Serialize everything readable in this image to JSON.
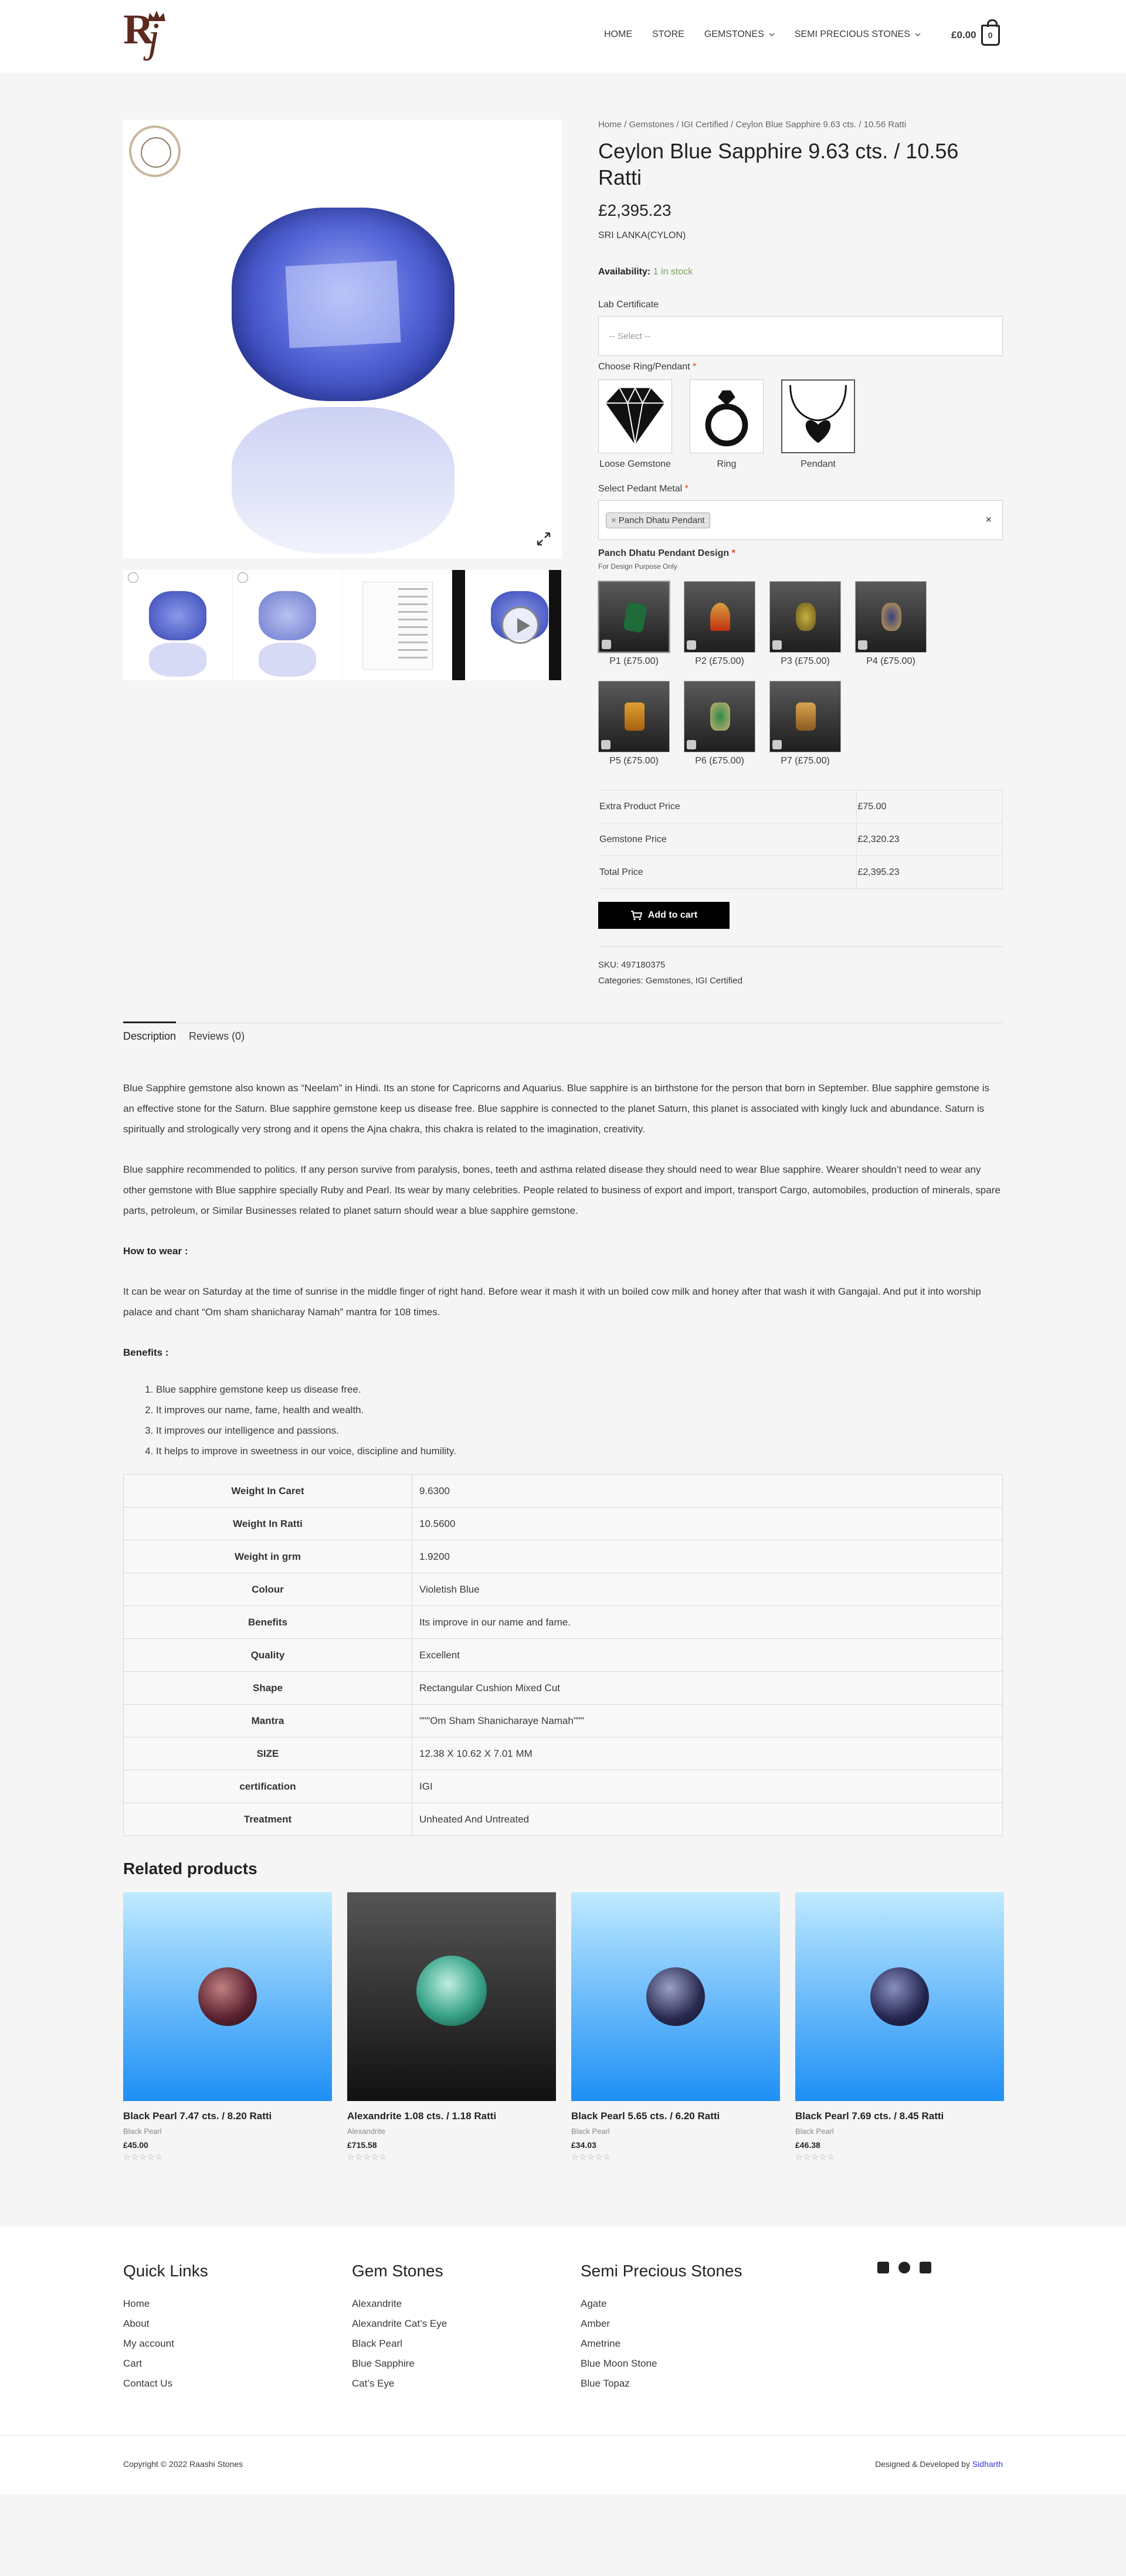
{
  "header": {
    "logo_text": "Rj",
    "nav": [
      "HOME",
      "STORE",
      "GEMSTONES",
      "SEMI PRECIOUS STONES"
    ],
    "cart_total": "£0.00",
    "cart_count": "0"
  },
  "product": {
    "breadcrumb": "Home / Gemstones / IGI Certified / Ceylon Blue Sapphire 9.63 cts. / 10.56 Ratti",
    "title": "Ceylon Blue Sapphire 9.63 cts. / 10.56 Ratti",
    "price": "£2,395.23",
    "origin": "SRI LANKA(CYLON)",
    "availability_label": "Availability:",
    "availability_value": "1 in stock",
    "lab_certificate_label": "Lab Certificate",
    "lab_certificate_placeholder": "-- Select --",
    "choose_label": "Choose Ring/Pendant",
    "choices": [
      "Loose Gemstone",
      "Ring",
      "Pendant"
    ],
    "metal_label": "Select Pedant Metal",
    "metal_selected": "Panch Dhatu Pendant",
    "design_label": "Panch Dhatu Pendant Design",
    "design_sub": "For Design Purpose Only",
    "designs": [
      "P1 (£75.00)",
      "P2 (£75.00)",
      "P3 (£75.00)",
      "P4 (£75.00)",
      "P5 (£75.00)",
      "P6 (£75.00)",
      "P7 (£75.00)"
    ],
    "price_rows": [
      {
        "label": "Extra Product Price",
        "value": "£75.00"
      },
      {
        "label": "Gemstone Price",
        "value": "£2,320.23"
      },
      {
        "label": "Total Price",
        "value": "£2,395.23"
      }
    ],
    "add_to_cart": "Add to cart",
    "sku": "SKU: 497180375",
    "categories_label": "Categories:",
    "categories": "Gemstones, IGI Certified"
  },
  "tabs": [
    "Description",
    "Reviews (0)"
  ],
  "description": {
    "p1": "Blue Sapphire gemstone also known as “Neelam” in Hindi. Its an stone for Capricorns and Aquarius. Blue sapphire is an birthstone for the person that born in September. Blue sapphire gemstone is an effective stone for the Saturn. Blue sapphire gemstone keep us disease free. Blue sapphire is connected to the planet Saturn, this planet is associated with kingly luck and abundance. Saturn is spiritually and strologically very strong and it opens the Ajna chakra, this chakra is related to the imagination, creativity.",
    "p2": "Blue sapphire recommended to politics. If any person survive from paralysis, bones, teeth and asthma related disease they should need to wear Blue sapphire. Wearer shouldn’t need to wear any other gemstone with Blue sapphire specially Ruby and Pearl. Its wear by many celebrities. People related to business of export and import, transport Cargo, automobiles, production of minerals, spare parts, petroleum, or Similar Businesses related to planet saturn should wear a blue sapphire gemstone.",
    "how_heading": "How to wear :",
    "how_text": "It can be wear on Saturday at the time of sunrise in the middle finger of right hand. Before wear it mash it with un boiled cow milk and honey after that wash it with Gangajal. And put it into worship palace and chant “Om sham shanicharay Namah” mantra for 108 times.",
    "benefits_heading": "Benefits :",
    "benefits": [
      "Blue sapphire gemstone keep us disease free.",
      "It improves our name, fame, health and wealth.",
      "It improves our intelligence and passions.",
      "It helps to improve in sweetness in our voice, discipline and humility."
    ]
  },
  "specs": [
    {
      "k": "Weight In Caret",
      "v": "9.6300"
    },
    {
      "k": "Weight In Ratti",
      "v": "10.5600"
    },
    {
      "k": "Weight in grm",
      "v": "1.9200"
    },
    {
      "k": "Colour",
      "v": "Violetish Blue"
    },
    {
      "k": "Benefits",
      "v": "Its improve in our name and fame."
    },
    {
      "k": "Quality",
      "v": "Excellent"
    },
    {
      "k": "Shape",
      "v": "Rectangular Cushion Mixed Cut"
    },
    {
      "k": "Mantra",
      "v": "\"\"\"Om Sham Shanicharaye Namah\"\"\""
    },
    {
      "k": "SIZE",
      "v": "12.38 X 10.62 X 7.01 MM"
    },
    {
      "k": "certification",
      "v": "IGI"
    },
    {
      "k": "Treatment",
      "v": "Unheated And Untreated"
    }
  ],
  "related": {
    "title": "Related products",
    "items": [
      {
        "name": "Black Pearl 7.47 cts. / 8.20 Ratti",
        "category": "Black Pearl",
        "price": "£45.00",
        "stars": "☆☆☆☆☆"
      },
      {
        "name": "Alexandrite 1.08 cts. / 1.18 Ratti",
        "category": "Alexandrite",
        "price": "£715.58",
        "stars": "☆☆☆☆☆"
      },
      {
        "name": "Black Pearl 5.65 cts. / 6.20 Ratti",
        "category": "Black Pearl",
        "price": "£34.03",
        "stars": "☆☆☆☆☆"
      },
      {
        "name": "Black Pearl 7.69 cts. / 8.45 Ratti",
        "category": "Black Pearl",
        "price": "£46.38",
        "stars": "☆☆☆☆☆"
      }
    ]
  },
  "footer": {
    "quick_links_title": "Quick Links",
    "quick_links": [
      "Home",
      "About",
      "My account",
      "Cart",
      "Contact Us"
    ],
    "gem_title": "Gem Stones",
    "gem_links": [
      "Alexandrite",
      "Alexandrite Cat’s Eye",
      "Black Pearl",
      "Blue Sapphire",
      "Cat’s Eye"
    ],
    "semi_title": "Semi Precious Stones",
    "semi_links": [
      "Agate",
      "Amber",
      "Ametrine",
      "Blue Moon Stone",
      "Blue Topaz"
    ],
    "copyright": "Copyright © 2022 Raashi Stones",
    "credit_prefix": "Designed & Developed by",
    "credit_link": "Sidharth"
  },
  "colors": {
    "accent": "#77a464",
    "required": "#e2401c",
    "button": "#000000"
  }
}
